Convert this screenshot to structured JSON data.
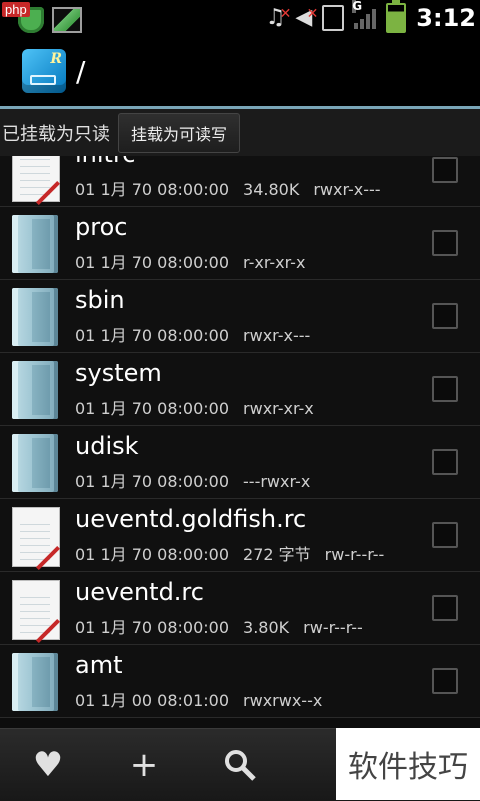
{
  "status_bar": {
    "badge": "php",
    "time": "3:12",
    "network": "G"
  },
  "title_bar": {
    "app_icon_letter": "R",
    "path": "/"
  },
  "mount_bar": {
    "status": "已挂载为只读",
    "button": "挂载为可读写"
  },
  "files": [
    {
      "name": "initrc",
      "date": "01 1月 70 08:00:00",
      "size": "34.80K",
      "perm": "rwxr-x---",
      "type": "file"
    },
    {
      "name": "proc",
      "date": "01 1月 70 08:00:00",
      "size": "",
      "perm": "r-xr-xr-x",
      "type": "folder"
    },
    {
      "name": "sbin",
      "date": "01 1月 70 08:00:00",
      "size": "",
      "perm": "rwxr-x---",
      "type": "folder"
    },
    {
      "name": "system",
      "date": "01 1月 70 08:00:00",
      "size": "",
      "perm": "rwxr-xr-x",
      "type": "folder"
    },
    {
      "name": "udisk",
      "date": "01 1月 70 08:00:00",
      "size": "",
      "perm": "---rwxr-x",
      "type": "folder"
    },
    {
      "name": "ueventd.goldfish.rc",
      "date": "01 1月 70 08:00:00",
      "size": "272 字节",
      "perm": "rw-r--r--",
      "type": "file"
    },
    {
      "name": "ueventd.rc",
      "date": "01 1月 70 08:00:00",
      "size": "3.80K",
      "perm": "rw-r--r--",
      "type": "file"
    },
    {
      "name": "amt",
      "date": "01 1月 00 08:01:00",
      "size": "",
      "perm": "rwxrwx--x",
      "type": "folder"
    }
  ],
  "watermark": "软件技巧"
}
